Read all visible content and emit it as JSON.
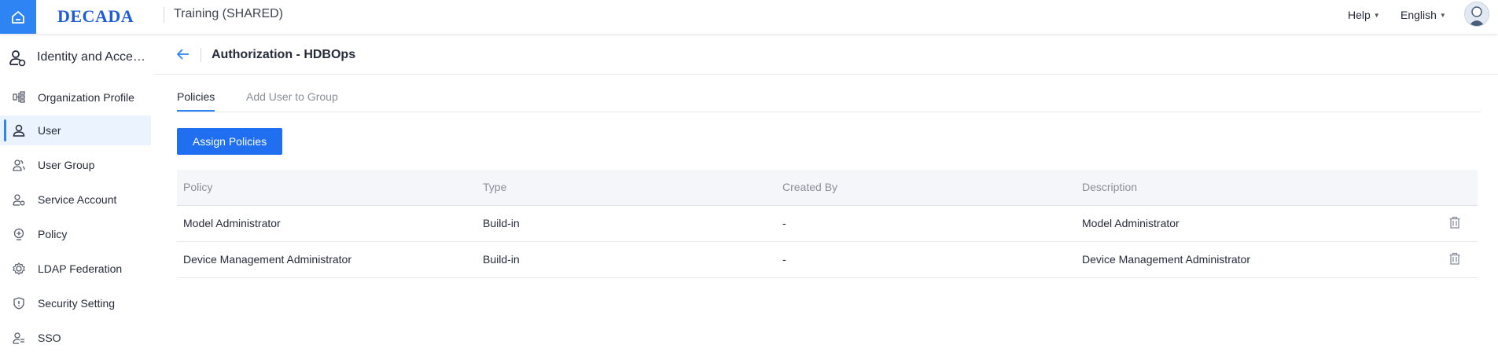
{
  "topbar": {
    "logo": "DECADA",
    "project": "Training (SHARED)",
    "help_label": "Help",
    "language_label": "English"
  },
  "sidebar": {
    "header": "Identity and Access Management",
    "items": [
      {
        "label": "Organization Profile",
        "icon": "org-tree-icon",
        "active": false
      },
      {
        "label": "User",
        "icon": "user-icon",
        "active": true
      },
      {
        "label": "User Group",
        "icon": "user-group-icon",
        "active": false
      },
      {
        "label": "Service Account",
        "icon": "service-account-icon",
        "active": false
      },
      {
        "label": "Policy",
        "icon": "policy-icon",
        "active": false
      },
      {
        "label": "LDAP Federation",
        "icon": "ldap-icon",
        "active": false
      },
      {
        "label": "Security Setting",
        "icon": "shield-icon",
        "active": false
      },
      {
        "label": "SSO",
        "icon": "sso-icon",
        "active": false
      }
    ]
  },
  "page": {
    "title": "Authorization - HDBOps",
    "tabs": [
      {
        "label": "Policies",
        "active": true
      },
      {
        "label": "Add User to Group",
        "active": false
      }
    ],
    "assign_button": "Assign Policies"
  },
  "table": {
    "columns": [
      "Policy",
      "Type",
      "Created By",
      "Description"
    ],
    "rows": [
      {
        "policy": "Model Administrator",
        "type": "Build-in",
        "created_by": "-",
        "description": "Model Administrator"
      },
      {
        "policy": "Device Management Administrator",
        "type": "Build-in",
        "created_by": "-",
        "description": "Device Management Administrator"
      }
    ]
  },
  "colors": {
    "accent": "#2f84f4",
    "primary_button": "#1f6ff0",
    "active_bg": "#ebf3fe"
  }
}
